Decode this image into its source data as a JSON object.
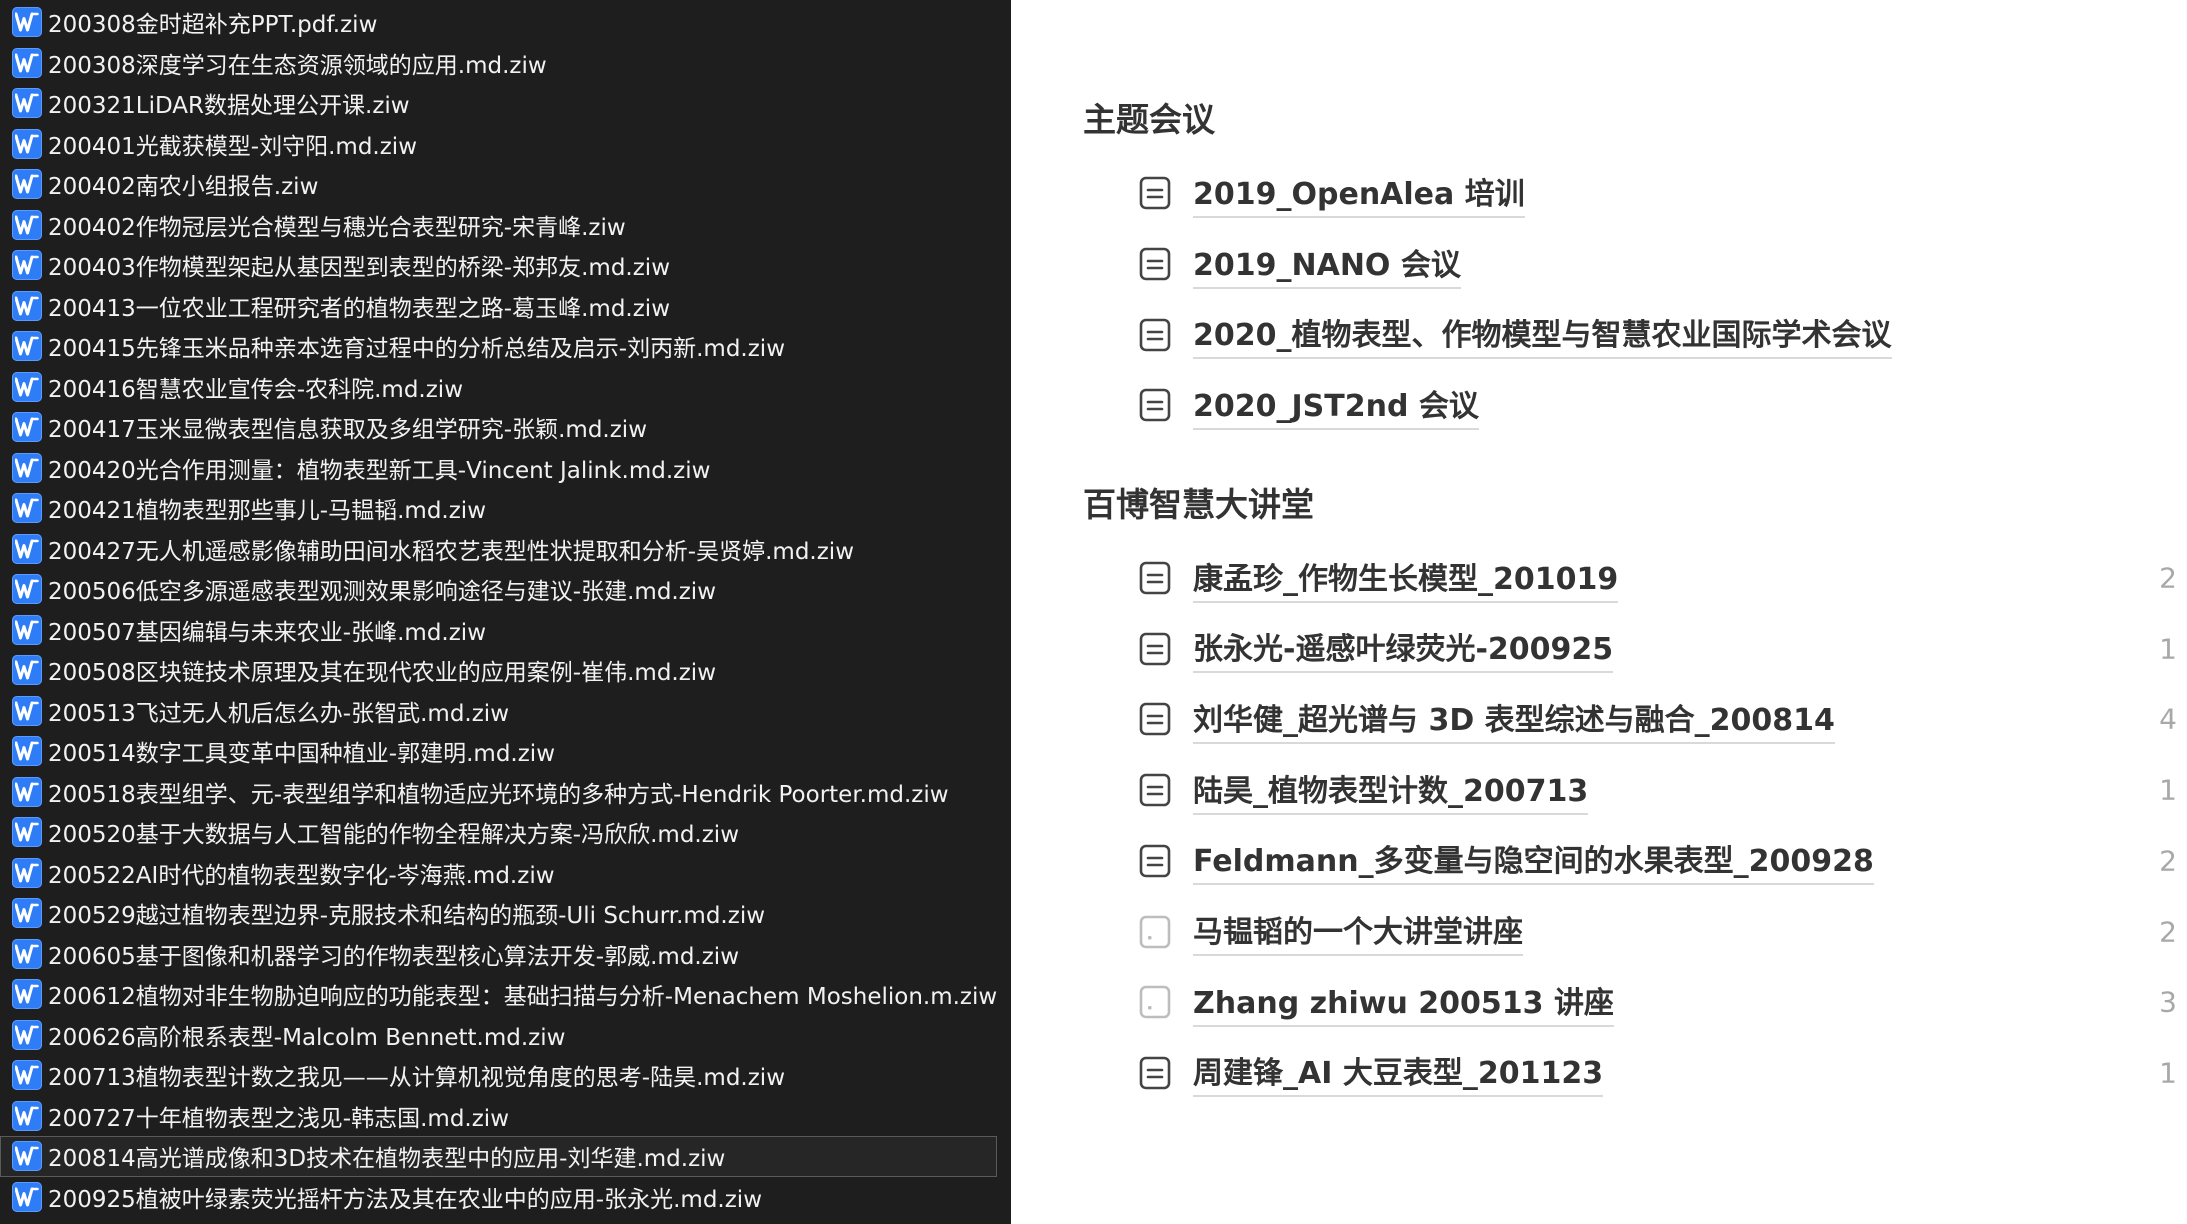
{
  "files": [
    {
      "name": "200308金时超补充PPT.pdf.ziw"
    },
    {
      "name": "200308深度学习在生态资源领域的应用.md.ziw"
    },
    {
      "name": "200321LiDAR数据处理公开课.ziw"
    },
    {
      "name": "200401光截获模型-刘守阳.md.ziw"
    },
    {
      "name": "200402南农小组报告.ziw"
    },
    {
      "name": "200402作物冠层光合模型与穗光合表型研究-宋青峰.ziw"
    },
    {
      "name": "200403作物模型架起从基因型到表型的桥梁-郑邦友.md.ziw"
    },
    {
      "name": "200413一位农业工程研究者的植物表型之路-葛玉峰.md.ziw"
    },
    {
      "name": "200415先锋玉米品种亲本选育过程中的分析总结及启示-刘丙新.md.ziw"
    },
    {
      "name": "200416智慧农业宣传会-农科院.md.ziw"
    },
    {
      "name": "200417玉米显微表型信息获取及多组学研究-张颖.md.ziw"
    },
    {
      "name": "200420光合作用测量：植物表型新工具-Vincent Jalink.md.ziw"
    },
    {
      "name": "200421植物表型那些事儿-马韫韬.md.ziw"
    },
    {
      "name": "200427无人机遥感影像辅助田间水稻农艺表型性状提取和分析-吴贤婷.md.ziw"
    },
    {
      "name": "200506低空多源遥感表型观测效果影响途径与建议-张建.md.ziw"
    },
    {
      "name": "200507基因编辑与未来农业-张峰.md.ziw"
    },
    {
      "name": "200508区块链技术原理及其在现代农业的应用案例-崔伟.md.ziw"
    },
    {
      "name": "200513飞过无人机后怎么办-张智武.md.ziw"
    },
    {
      "name": "200514数字工具变革中国种植业-郭建明.md.ziw"
    },
    {
      "name": "200518表型组学、元-表型组学和植物适应光环境的多种方式-Hendrik Poorter.md.ziw"
    },
    {
      "name": "200520基于大数据与人工智能的作物全程解决方案-冯欣欣.md.ziw"
    },
    {
      "name": "200522AI时代的植物表型数字化-岑海燕.md.ziw"
    },
    {
      "name": "200529越过植物表型边界-克服技术和结构的瓶颈-Uli Schurr.md.ziw"
    },
    {
      "name": "200605基于图像和机器学习的作物表型核心算法开发-郭威.md.ziw"
    },
    {
      "name": "200612植物对非生物胁迫响应的功能表型：基础扫描与分析-Menachem Moshelion.m.ziw"
    },
    {
      "name": "200626高阶根系表型-Malcolm Bennett.md.ziw"
    },
    {
      "name": "200713植物表型计数之我见——从计算机视觉角度的思考-陆昊.md.ziw"
    },
    {
      "name": "200727十年植物表型之浅见-韩志国.md.ziw"
    },
    {
      "name": "200814高光谱成像和3D技术在植物表型中的应用-刘华建.md.ziw",
      "selected": true
    },
    {
      "name": "200925植被叶绿素荧光摇杆方法及其在农业中的应用-张永光.md.ziw"
    }
  ],
  "sections": [
    {
      "title": "主题会议",
      "items": [
        {
          "label": "2019_OpenAlea 培训",
          "icon": "doc",
          "count": ""
        },
        {
          "label": "2019_NANO 会议",
          "icon": "doc",
          "count": ""
        },
        {
          "label": "2020_植物表型、作物模型与智慧农业国际学术会议",
          "icon": "doc",
          "count": ""
        },
        {
          "label": "2020_JST2nd 会议",
          "icon": "doc",
          "count": ""
        }
      ]
    },
    {
      "title": "百博智慧大讲堂",
      "items": [
        {
          "label": "康孟珍_作物生长模型_201019",
          "icon": "doc",
          "count": "2"
        },
        {
          "label": "张永光-遥感叶绿荧光-200925",
          "icon": "doc",
          "count": "1"
        },
        {
          "label": "刘华健_超光谱与 3D 表型综述与融合_200814",
          "icon": "doc",
          "count": "4"
        },
        {
          "label": "陆昊_植物表型计数_200713",
          "icon": "doc",
          "count": "1"
        },
        {
          "label": "Feldmann_多变量与隐空间的水果表型_200928",
          "icon": "doc",
          "count": "2"
        },
        {
          "label": "马韫韬的一个大讲堂讲座",
          "icon": "empty-doc",
          "count": "2"
        },
        {
          "label": "Zhang zhiwu 200513 讲座",
          "icon": "empty-doc",
          "count": "3"
        },
        {
          "label": "周建锋_AI 大豆表型_201123",
          "icon": "doc",
          "count": "1"
        }
      ]
    }
  ],
  "colors": {
    "left_bg": "#1e1e1e",
    "file_icon": "#2f7df6",
    "text_dark": "#333333",
    "count_gray": "#a8a8a8"
  }
}
